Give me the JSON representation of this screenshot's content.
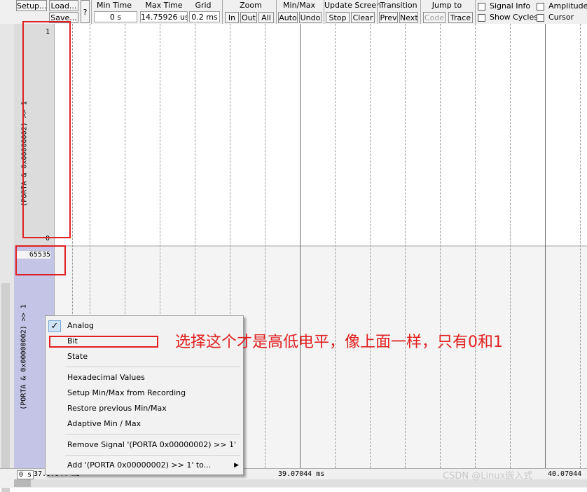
{
  "toolbar": {
    "setup": "Setup...",
    "load": "Load...",
    "save": "Save...",
    "help": "?",
    "min_time": {
      "label": "Min Time",
      "value": "0 s"
    },
    "max_time": {
      "label": "Max Time",
      "value": "14.75926 us"
    },
    "grid": {
      "label": "Grid",
      "value": "0.2 ms"
    },
    "zoom": {
      "label": "Zoom",
      "in": "In",
      "out": "Out",
      "all": "All"
    },
    "minmax": {
      "label": "Min/Max",
      "auto": "Auto",
      "undo": "Undo"
    },
    "update": {
      "label": "Update Screen",
      "stop": "Stop",
      "clear": "Clear"
    },
    "transition": {
      "label": "Transition",
      "prev": "Prev",
      "next": "Next"
    },
    "jump": {
      "label": "Jump to",
      "code": "Code",
      "trace": "Trace"
    },
    "checkboxes": {
      "signal_info": "Signal Info",
      "amplitude": "Amplitude",
      "show_cycles": "Show Cycles",
      "cursor": "Cursor"
    }
  },
  "signals": [
    {
      "name": "(PORTA & 0x00000002) >> 1",
      "max": "1",
      "min": "0"
    },
    {
      "name": "(PORTA & 0x00000002) >> 1",
      "max": "65535"
    }
  ],
  "status": {
    "left": "0 s",
    "left_time": "37.07044 ms",
    "center_time": "39.07044 ms",
    "right_time": "40.07044"
  },
  "context_menu": {
    "items": [
      {
        "label": "Analog",
        "checked": true
      },
      {
        "label": "Bit"
      },
      {
        "label": "State"
      },
      {
        "label": "Hexadecimal Values"
      },
      {
        "label": "Setup Min/Max from Recording"
      },
      {
        "label": "Restore previous Min/Max"
      },
      {
        "label": "Adaptive Min / Max"
      },
      {
        "label": "Remove Signal '(PORTA  0x00000002) >> 1'"
      },
      {
        "label": "Add '(PORTA  0x00000002) >> 1' to..."
      }
    ]
  },
  "annotation": "选择这个才是高低电平，像上面一样，只有0和1",
  "watermark": "CSDN @Linux嵌入式",
  "colors": {
    "annotation_red": "#e02020",
    "panel2_bg": "#c4c4e6",
    "panel1_bg": "#dcdcdc"
  }
}
